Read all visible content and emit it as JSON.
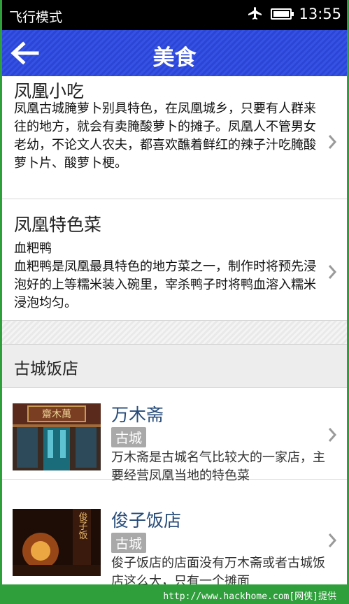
{
  "status_bar": {
    "mode": "飞行模式",
    "time": "13:55",
    "plane_icon": "airplane-icon",
    "battery_icon": "battery-icon"
  },
  "header": {
    "back_icon": "back-arrow-icon",
    "title": "美食"
  },
  "snacks": {
    "title": "凤凰小吃",
    "text": "凤凰古城腌萝卜别具特色，在凤凰城乡，只要有人群来往的地方，就会有卖腌酸萝卜的摊子。凤凰人不管男女老幼，不论文人农夫，都喜欢醮着鲜红的辣子汁吃腌酸萝卜片、酸萝卜梗。"
  },
  "specialty": {
    "title": "凤凰特色菜",
    "subtitle": "血粑鸭",
    "text": "血粑鸭是凤凰最具特色的地方菜之一，制作时将预先浸泡好的上等糯米装入碗里，宰杀鸭子时将鸭血溶入糯米浸泡均匀。"
  },
  "section": {
    "title": "古城饭店"
  },
  "restaurants": [
    {
      "name": "万木斋",
      "sign_text": "齋木萬",
      "tag": "古城",
      "desc": "万木斋是古城名气比较大的一家店，主要经营凤凰当地的特色菜"
    },
    {
      "name": "俊子饭店",
      "sign_text": "俊子饭",
      "tag": "古城",
      "desc": "俊子饭店的店面没有万木斋或者古城饭店这么大，只有一个摊面"
    }
  ],
  "footer": {
    "text": "http://www.hackhome.com[网侠]提供"
  }
}
